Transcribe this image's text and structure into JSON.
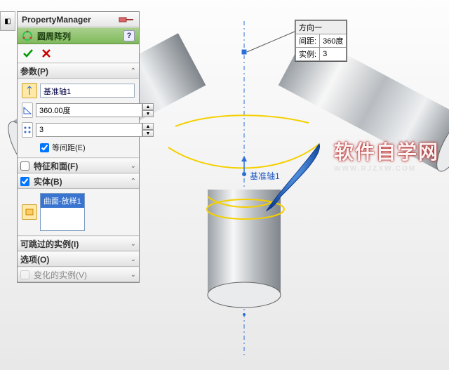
{
  "pm": {
    "title": "PropertyManager"
  },
  "feature": {
    "title": "圆周阵列"
  },
  "sections": {
    "params": {
      "label": "参数(P)",
      "axis": "基准轴1",
      "angle": "360.00度",
      "count": "3",
      "equal_spacing": "等间距(E)"
    },
    "features_faces": {
      "label": "特征和面(F)"
    },
    "bodies": {
      "label": "实体(B)",
      "item": "曲面-放样1"
    },
    "skip_instances": {
      "label": "可跳过的实例(I)"
    },
    "options": {
      "label": "选项(O)"
    },
    "varied": {
      "label": "变化的实例(V)"
    }
  },
  "callout": {
    "dir_label": "方向一",
    "spacing_label": "间距:",
    "spacing_value": "360度",
    "instances_label": "实例:",
    "instances_value": "3"
  },
  "axis_label": "基准轴1",
  "watermark": {
    "line1": "软件自学网",
    "line2": "WWW.RJZXW.COM"
  }
}
